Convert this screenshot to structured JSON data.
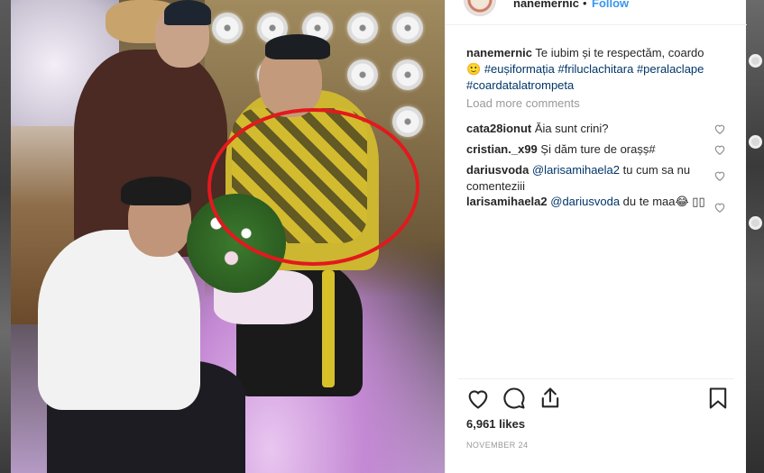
{
  "post": {
    "username": "nanemernic",
    "follow_separator": "•",
    "follow_label": "Follow",
    "caption_text": "Te iubim și te respectăm, coardo",
    "caption_emoji": "🙂",
    "hashtags": [
      "#eușiformația",
      "#friluclachitara",
      "#peralaclape",
      "#coardatalatrompeta"
    ],
    "load_more": "Load more comments",
    "likes": "6,961 likes",
    "date": "NOVEMBER 24"
  },
  "comments": [
    {
      "user": "cata28ionut",
      "mention": "",
      "text": "Ăia sunt crini?"
    },
    {
      "user": "cristian._x99",
      "mention": "",
      "text": "Și dăm ture de orașș#"
    },
    {
      "user": "dariusvoda",
      "mention": "@larisamihaela2",
      "text": "tu cum sa nu comenteziii"
    },
    {
      "user": "larisamihaela2",
      "mention": "@dariusvoda",
      "text": "du te maa😂 ▯▯"
    }
  ],
  "icons": {
    "like": "heart-icon",
    "comment": "comment-icon",
    "share": "share-icon",
    "save": "bookmark-icon"
  },
  "colors": {
    "annotation": "#e2191d",
    "link_blue": "#3897f0",
    "hashtag": "#003569",
    "muted": "#999999"
  }
}
